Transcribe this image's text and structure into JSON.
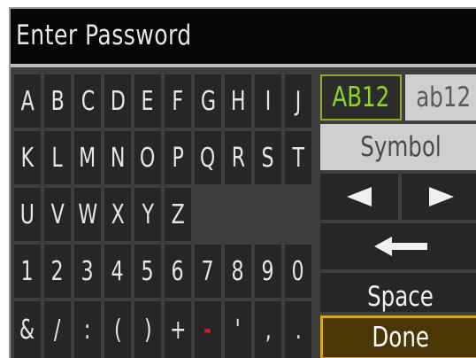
{
  "title": "Enter Password",
  "keys": [
    [
      "A",
      "B",
      "C",
      "D",
      "E",
      "F",
      "G",
      "H",
      "I",
      "J"
    ],
    [
      "K",
      "L",
      "M",
      "N",
      "O",
      "P",
      "Q",
      "R",
      "S",
      "T"
    ],
    [
      "U",
      "V",
      "W",
      "X",
      "Y",
      "Z"
    ],
    [
      "1",
      "2",
      "3",
      "4",
      "5",
      "6",
      "7",
      "8",
      "9",
      "0"
    ],
    [
      "&",
      "/",
      ":",
      "(",
      ")",
      "+",
      "-",
      "'",
      ",",
      "."
    ]
  ],
  "side": {
    "mode_upper": "AB12",
    "mode_lower": "ab12",
    "symbol": "Symbol",
    "space": "Space",
    "done": "Done"
  },
  "icons": {
    "left": "left-triangle-icon",
    "right": "right-triangle-icon",
    "backspace": "left-arrow-icon"
  },
  "colors": {
    "accent_green": "#8cd622",
    "done_border": "#d9a41e",
    "minus_red": "#e01818"
  }
}
